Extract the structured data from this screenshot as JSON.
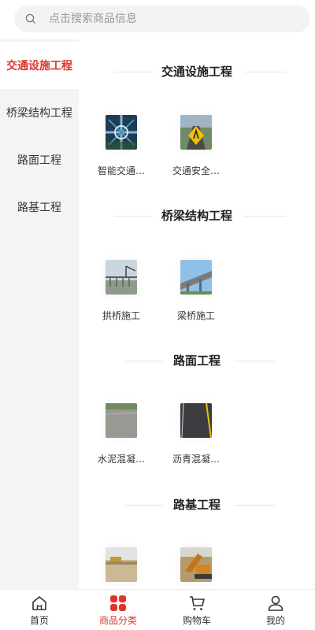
{
  "search": {
    "placeholder": "点击搜索商品信息"
  },
  "sidebar": {
    "items": [
      {
        "label": "交通设施工程",
        "active": true
      },
      {
        "label": "桥梁结构工程",
        "active": false
      },
      {
        "label": "路面工程",
        "active": false
      },
      {
        "label": "路基工程",
        "active": false
      }
    ]
  },
  "sections": [
    {
      "title": "交通设施工程",
      "products": [
        {
          "name": "智能交通…"
        },
        {
          "name": "交通安全…"
        }
      ]
    },
    {
      "title": "桥梁结构工程",
      "products": [
        {
          "name": "拱桥施工"
        },
        {
          "name": "梁桥施工"
        }
      ]
    },
    {
      "title": "路面工程",
      "products": [
        {
          "name": "水泥混凝…"
        },
        {
          "name": "沥青混凝…"
        }
      ]
    },
    {
      "title": "路基工程",
      "products": [
        {
          "name": ""
        },
        {
          "name": ""
        }
      ]
    }
  ],
  "tabbar": {
    "items": [
      {
        "label": "首页",
        "icon": "home-icon",
        "active": false
      },
      {
        "label": "商品分类",
        "icon": "category-icon",
        "active": true
      },
      {
        "label": "购物车",
        "icon": "cart-icon",
        "active": false
      },
      {
        "label": "我的",
        "icon": "user-icon",
        "active": false
      }
    ]
  },
  "colors": {
    "accent": "#e0352b",
    "sidebar_bg": "#f4f4f4",
    "search_bg": "#f3f3f3"
  }
}
